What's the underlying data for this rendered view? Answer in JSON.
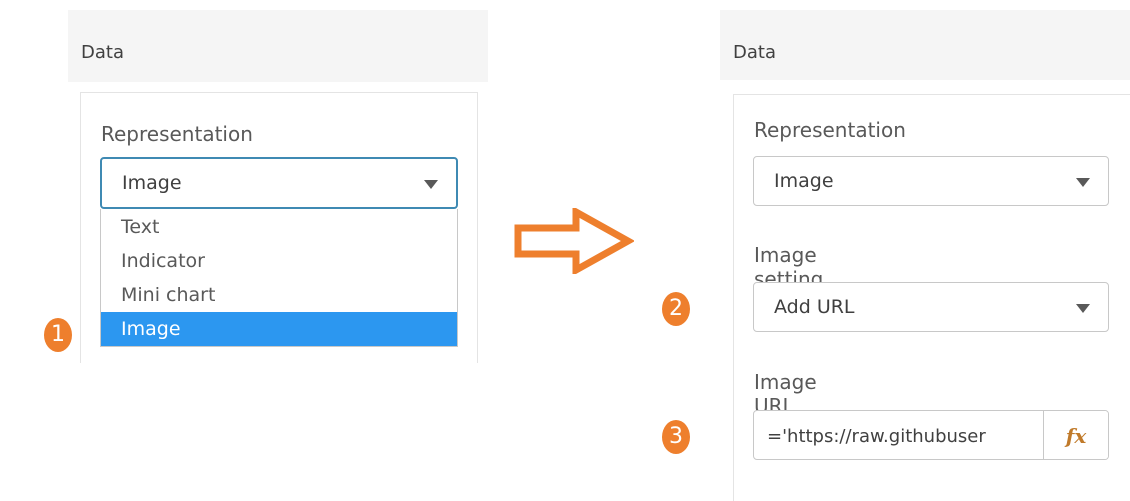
{
  "left_panel": {
    "header": "Data",
    "representation_label": "Representation",
    "representation_value": "Image",
    "dropdown_options": [
      "Text",
      "Indicator",
      "Mini chart",
      "Image"
    ],
    "selected_option_index": 3
  },
  "right_panel": {
    "header": "Data",
    "representation_label": "Representation",
    "representation_value": "Image",
    "image_setting_label": "Image setting",
    "image_setting_value": "Add URL",
    "image_url_label": "Image URL",
    "image_url_value": "='https://raw.githubuser",
    "fx_label": "fx"
  },
  "steps": [
    "1",
    "2",
    "3"
  ],
  "colors": {
    "accent_orange": "#ee7f2d",
    "selected_blue": "#2c97f0",
    "focus_border": "#3f8ab3",
    "header_bg": "#f5f5f5"
  },
  "icons": {
    "arrow": "right-arrow-icon",
    "caret": "chevron-down-icon",
    "fx": "fx-icon"
  }
}
